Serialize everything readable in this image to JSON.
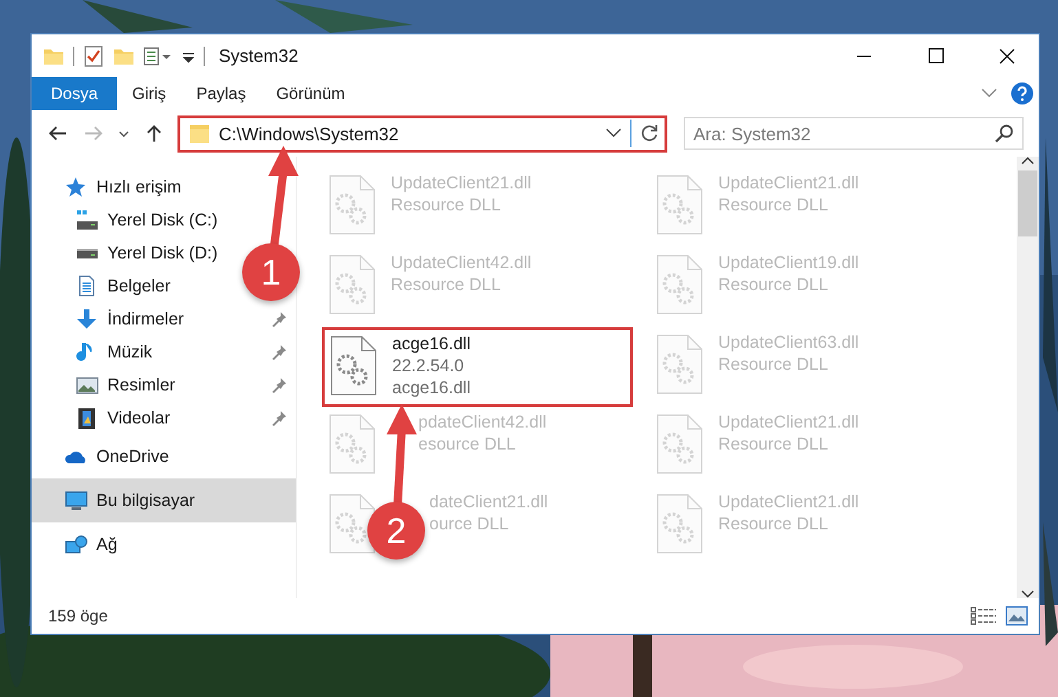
{
  "window": {
    "title": "System32"
  },
  "ribbon_tabs": [
    {
      "label": "Dosya",
      "selected": true
    },
    {
      "label": "Giriş",
      "selected": false
    },
    {
      "label": "Paylaş",
      "selected": false
    },
    {
      "label": "Görünüm",
      "selected": false
    }
  ],
  "address": {
    "path": "C:\\Windows\\System32",
    "highlighted": true
  },
  "search": {
    "placeholder": "Ara: System32"
  },
  "nav": [
    {
      "label": "Hızlı erişim",
      "kind": "star",
      "selected": false,
      "children": [
        {
          "label": "Yerel Disk (C:)",
          "kind": "disk-c",
          "selected": false
        },
        {
          "label": "Yerel Disk (D:)",
          "kind": "disk",
          "selected": false
        },
        {
          "label": "Belgeler",
          "kind": "documents",
          "selected": false
        },
        {
          "label": "İndirmeler",
          "kind": "downloads",
          "pinned": true,
          "selected": false
        },
        {
          "label": "Müzik",
          "kind": "music",
          "pinned": true,
          "selected": false
        },
        {
          "label": "Resimler",
          "kind": "pictures",
          "pinned": true,
          "selected": false
        },
        {
          "label": "Videolar",
          "kind": "videos",
          "pinned": true,
          "selected": false
        }
      ]
    },
    {
      "label": "OneDrive",
      "kind": "cloud",
      "selected": false
    },
    {
      "label": "Bu bilgisayar",
      "kind": "computer",
      "selected": true
    },
    {
      "label": "Ağ",
      "kind": "network",
      "selected": false
    }
  ],
  "files": [
    {
      "name": "UpdateClient21.dll",
      "lines": [
        "Resource DLL"
      ],
      "faded": true,
      "highlighted": false
    },
    {
      "name": "UpdateClient21.dll",
      "lines": [
        "Resource DLL"
      ],
      "faded": true,
      "highlighted": false
    },
    {
      "name": "UpdateClient42.dll",
      "lines": [
        "Resource DLL"
      ],
      "faded": true,
      "highlighted": false
    },
    {
      "name": "UpdateClient19.dll",
      "lines": [
        "Resource DLL"
      ],
      "faded": true,
      "highlighted": false
    },
    {
      "name": "acge16.dll",
      "lines": [
        "22.2.54.0",
        "acge16.dll"
      ],
      "faded": false,
      "highlighted": true
    },
    {
      "name": "UpdateClient63.dll",
      "lines": [
        "Resource DLL"
      ],
      "faded": true,
      "highlighted": false
    },
    {
      "name": "pdateClient42.dll",
      "lines": [
        "esource DLL"
      ],
      "faded": true,
      "highlighted": false
    },
    {
      "name": "UpdateClient21.dll",
      "lines": [
        "Resource DLL"
      ],
      "faded": true,
      "highlighted": false
    },
    {
      "name": "dateClient21.dll",
      "lines": [
        "ource DLL"
      ],
      "faded": true,
      "highlighted": false
    },
    {
      "name": "UpdateClient21.dll",
      "lines": [
        "Resource DLL"
      ],
      "faded": true,
      "highlighted": false
    }
  ],
  "status_bar": {
    "item_count": "159 öge"
  },
  "annotations": [
    {
      "label": "1"
    },
    {
      "label": "2"
    }
  ]
}
